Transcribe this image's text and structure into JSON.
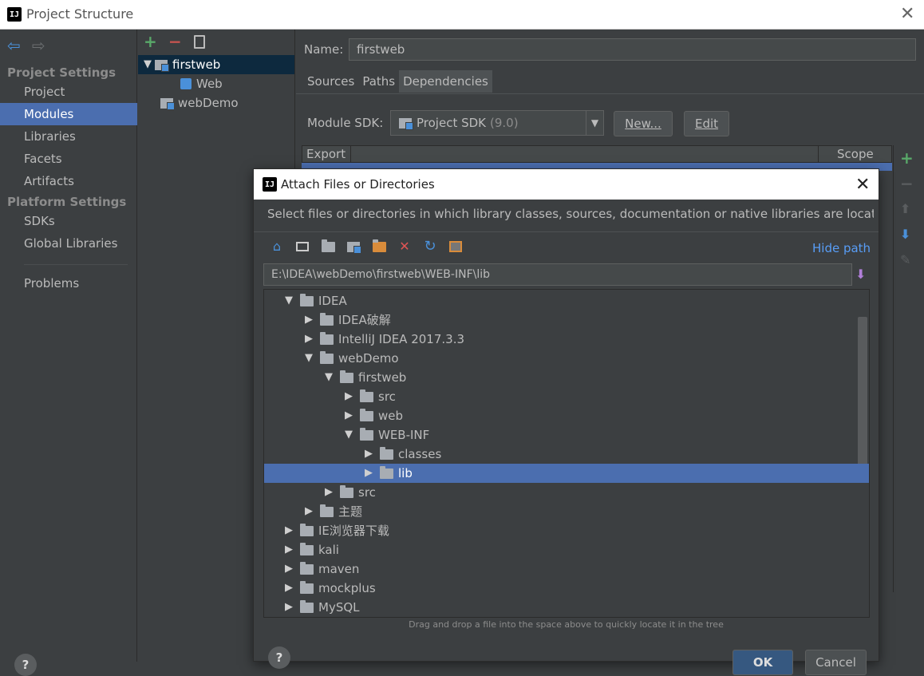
{
  "window": {
    "title": "Project Structure"
  },
  "sidebar": {
    "project_settings_header": "Project Settings",
    "project_items": [
      {
        "label": "Project"
      },
      {
        "label": "Modules",
        "selected": true
      },
      {
        "label": "Libraries"
      },
      {
        "label": "Facets"
      },
      {
        "label": "Artifacts"
      }
    ],
    "platform_settings_header": "Platform Settings",
    "platform_items": [
      {
        "label": "SDKs"
      },
      {
        "label": "Global Libraries"
      }
    ],
    "problems_label": "Problems"
  },
  "modules": {
    "items": [
      {
        "label": "firstweb",
        "expanded": true,
        "selected": true
      },
      {
        "label": "Web"
      },
      {
        "label": "webDemo"
      }
    ]
  },
  "module_settings": {
    "name_label": "Name:",
    "name_value": "firstweb",
    "tabs": [
      "Sources",
      "Paths",
      "Dependencies"
    ],
    "selected_tab": "Dependencies",
    "sdk_label": "Module SDK:",
    "sdk_value": "Project SDK",
    "sdk_version": "(9.0)",
    "new_button": "New...",
    "edit_button": "Edit",
    "col_export": "Export",
    "col_scope": "Scope"
  },
  "dialog": {
    "title": "Attach Files or Directories",
    "description": "Select files or directories in which library classes, sources, documentation or native libraries are located",
    "hide_path": "Hide path",
    "path_value": "E:\\IDEA\\webDemo\\firstweb\\WEB-INF\\lib",
    "tree": [
      {
        "label": "IDEA",
        "depth": 0,
        "expanded": true
      },
      {
        "label": "IDEA破解",
        "depth": 1,
        "expanded": false
      },
      {
        "label": "IntelliJ IDEA 2017.3.3",
        "depth": 1,
        "expanded": false
      },
      {
        "label": "webDemo",
        "depth": 1,
        "expanded": true
      },
      {
        "label": "firstweb",
        "depth": 2,
        "expanded": true
      },
      {
        "label": "src",
        "depth": 3,
        "expanded": false
      },
      {
        "label": "web",
        "depth": 3,
        "expanded": false
      },
      {
        "label": "WEB-INF",
        "depth": 3,
        "expanded": true
      },
      {
        "label": "classes",
        "depth": 4,
        "expanded": false
      },
      {
        "label": "lib",
        "depth": 4,
        "expanded": false,
        "selected": true
      },
      {
        "label": "src",
        "depth": 2,
        "expanded": false
      },
      {
        "label": "主题",
        "depth": 1,
        "expanded": false
      },
      {
        "label": "IE浏览器下载",
        "depth": 0,
        "expanded": false
      },
      {
        "label": "kali",
        "depth": 0,
        "expanded": false
      },
      {
        "label": "maven",
        "depth": 0,
        "expanded": false
      },
      {
        "label": "mockplus",
        "depth": 0,
        "expanded": false
      },
      {
        "label": "MySQL",
        "depth": 0,
        "expanded": false
      }
    ],
    "hint": "Drag and drop a file into the space above to quickly locate it in the tree",
    "ok_button": "OK",
    "cancel_button": "Cancel"
  },
  "colors": {
    "background": "#3c3f41",
    "selection": "#4b6eaf",
    "add_green": "#59a869",
    "remove_red": "#c75450",
    "link_blue": "#589df6"
  }
}
